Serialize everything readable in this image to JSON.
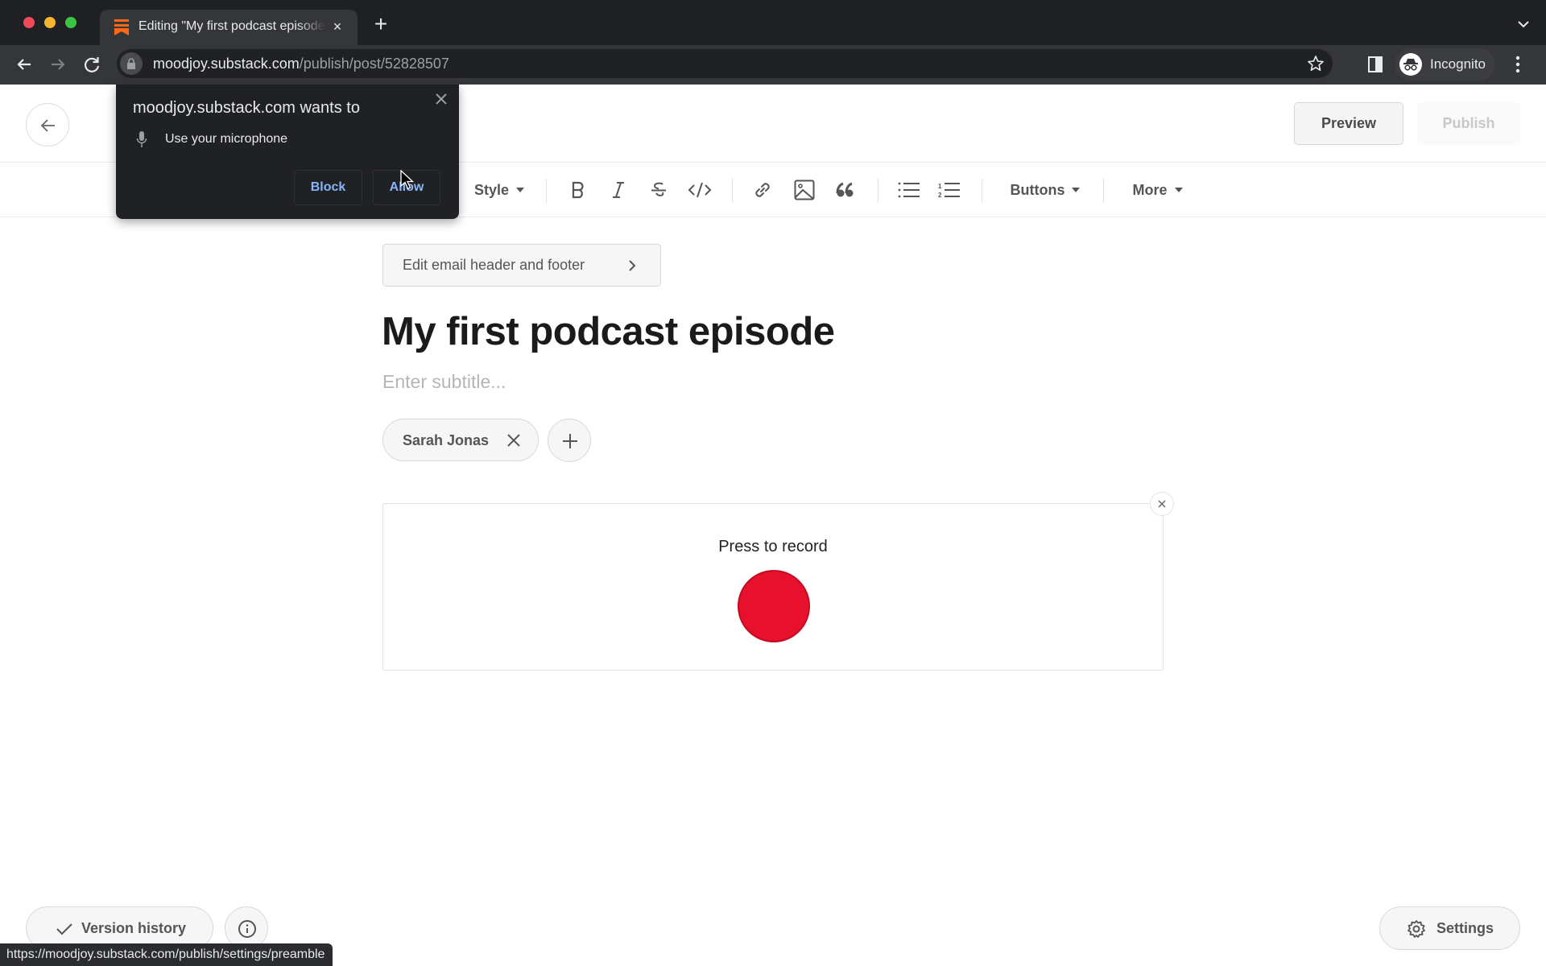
{
  "browser": {
    "tab_title": "Editing \"My first podcast episode\"",
    "tab_close": "×",
    "new_tab": "+",
    "url_host": "moodjoy.substack.com",
    "url_path": "/publish/post/52828507",
    "profile_label": "Incognito",
    "status_url": "https://moodjoy.substack.com/publish/settings/preamble",
    "accent_color": "#8ab4f8"
  },
  "permission_popup": {
    "title": "moodjoy.substack.com wants to",
    "permission": "Use your microphone",
    "block_label": "Block",
    "allow_label": "Allow"
  },
  "header": {
    "preview_label": "Preview",
    "publish_label": "Publish"
  },
  "editor_toolbar": {
    "style_label": "Style",
    "buttons_label": "Buttons",
    "more_label": "More",
    "icons": [
      "bold-icon",
      "italic-icon",
      "strikethrough-icon",
      "code-icon",
      "link-icon",
      "image-icon",
      "quote-icon",
      "bullet-list-icon",
      "numbered-list-icon"
    ]
  },
  "post": {
    "email_settings_label": "Edit email header and footer",
    "title": "My first podcast episode",
    "subtitle_placeholder": "Enter subtitle...",
    "authors": [
      {
        "name": "Sarah Jonas"
      }
    ]
  },
  "recorder": {
    "label": "Press to record",
    "record_color": "#e8112d"
  },
  "footer": {
    "version_history_label": "Version history",
    "settings_label": "Settings"
  }
}
